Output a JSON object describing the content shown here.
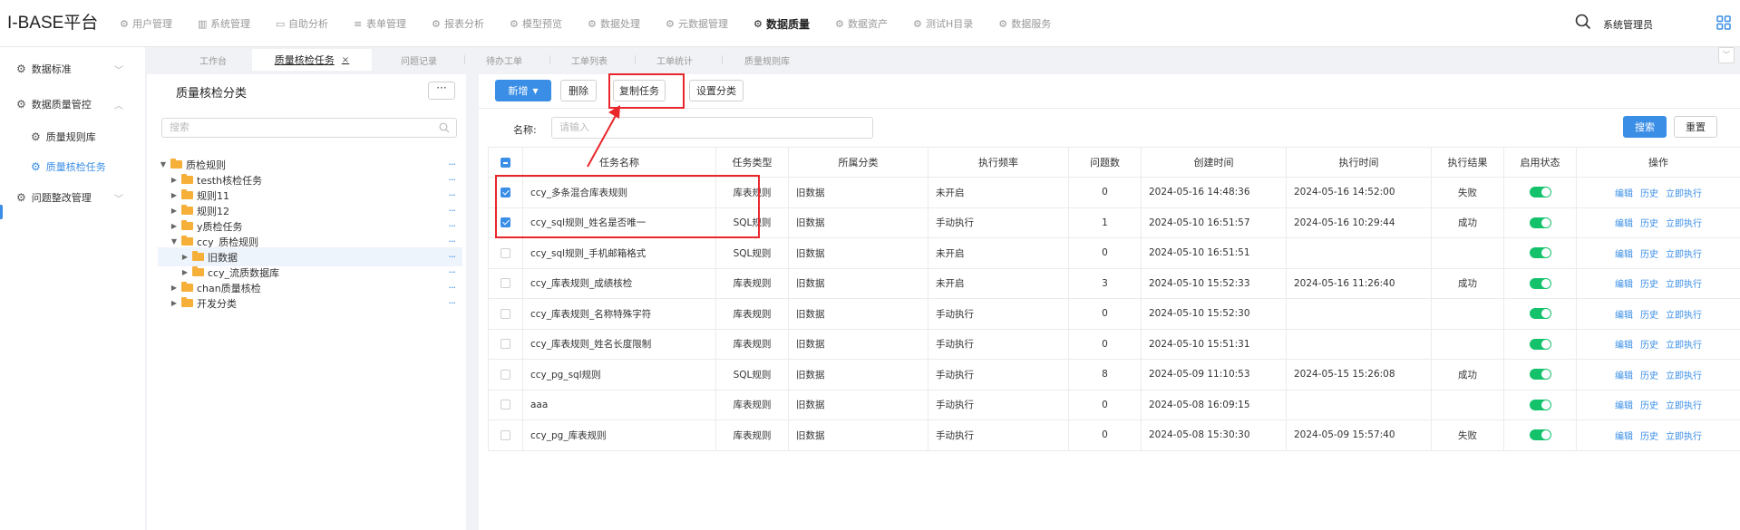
{
  "app": {
    "title": "I-BASE平台"
  },
  "topnav": [
    {
      "label": "用户管理",
      "icon": "gear-icon",
      "active": false
    },
    {
      "label": "系统管理",
      "icon": "chart-icon",
      "active": false
    },
    {
      "label": "自助分析",
      "icon": "monitor-icon",
      "active": false
    },
    {
      "label": "表单管理",
      "icon": "form-icon",
      "active": false
    },
    {
      "label": "报表分析",
      "icon": "gear-icon",
      "active": false
    },
    {
      "label": "模型预览",
      "icon": "gear-icon",
      "active": false
    },
    {
      "label": "数据处理",
      "icon": "gear-icon",
      "active": false
    },
    {
      "label": "元数据管理",
      "icon": "gear-icon",
      "active": false
    },
    {
      "label": "数据质量",
      "icon": "gear-icon",
      "active": true
    },
    {
      "label": "数据资产",
      "icon": "gear-icon",
      "active": false
    },
    {
      "label": "测试H目录",
      "icon": "gear-icon",
      "active": false
    },
    {
      "label": "数据服务",
      "icon": "gear-icon",
      "active": false
    }
  ],
  "user": {
    "name": "系统管理员"
  },
  "sidebar": {
    "items": [
      {
        "label": "数据标准"
      },
      {
        "label": "数据质量管控"
      },
      {
        "label": "质量规则库"
      },
      {
        "label": "质量核检任务"
      },
      {
        "label": "问题整改管理"
      }
    ]
  },
  "tabs": [
    {
      "label": "工作台"
    },
    {
      "label": "质量核检任务",
      "close": "×"
    },
    {
      "label": "问题记录"
    },
    {
      "label": "待办工单"
    },
    {
      "label": "工单列表"
    },
    {
      "label": "工单统计"
    },
    {
      "label": "质量规则库"
    }
  ],
  "tree": {
    "title": "质量核检分类",
    "more": "···",
    "search_placeholder": "搜索",
    "row_action": "···",
    "nodes": [
      {
        "label": "质检规则",
        "expanded": true
      },
      {
        "label": "testh核检任务"
      },
      {
        "label": "规则11"
      },
      {
        "label": "规则12"
      },
      {
        "label": "y质检任务"
      },
      {
        "label": "ccy_质检规则",
        "expanded": true
      },
      {
        "label": "旧数据",
        "selected": true
      },
      {
        "label": "ccy_流质数据库"
      },
      {
        "label": "chan质量核检"
      },
      {
        "label": "开发分类"
      }
    ]
  },
  "toolbar": {
    "add": "新增",
    "delete": "删除",
    "copy": "复制任务",
    "set_category": "设置分类",
    "search": "搜索",
    "reset": "重置"
  },
  "filter": {
    "name_label": "名称:",
    "name_placeholder": "请输入"
  },
  "table": {
    "headers": [
      "任务名称",
      "任务类型",
      "所属分类",
      "执行频率",
      "问题数",
      "创建时间",
      "执行时间",
      "执行结果",
      "启用状态",
      "操作"
    ],
    "actions": [
      "编辑",
      "历史",
      "立即执行"
    ],
    "rows": [
      {
        "checked": true,
        "name": "ccy_多条混合库表规则",
        "type": "库表规则",
        "category": "旧数据",
        "freq": "未开启",
        "issues": "0",
        "created": "2024-05-16 14:48:36",
        "executed": "2024-05-16 14:52:00",
        "result": "失败",
        "enabled": true
      },
      {
        "checked": true,
        "name": "ccy_sql规则_姓名是否唯一",
        "type": "SQL规则",
        "category": "旧数据",
        "freq": "手动执行",
        "issues": "1",
        "created": "2024-05-10 16:51:57",
        "executed": "2024-05-16 10:29:44",
        "result": "成功",
        "enabled": true
      },
      {
        "checked": false,
        "name": "ccy_sql规则_手机邮箱格式",
        "type": "SQL规则",
        "category": "旧数据",
        "freq": "未开启",
        "issues": "0",
        "created": "2024-05-10 16:51:51",
        "executed": "",
        "result": "",
        "enabled": true
      },
      {
        "checked": false,
        "name": "ccy_库表规则_成绩核检",
        "type": "库表规则",
        "category": "旧数据",
        "freq": "未开启",
        "issues": "3",
        "created": "2024-05-10 15:52:33",
        "executed": "2024-05-16 11:26:40",
        "result": "成功",
        "enabled": true
      },
      {
        "checked": false,
        "name": "ccy_库表规则_名称特殊字符",
        "type": "库表规则",
        "category": "旧数据",
        "freq": "手动执行",
        "issues": "0",
        "created": "2024-05-10 15:52:30",
        "executed": "",
        "result": "",
        "enabled": true
      },
      {
        "checked": false,
        "name": "ccy_库表规则_姓名长度限制",
        "type": "库表规则",
        "category": "旧数据",
        "freq": "手动执行",
        "issues": "0",
        "created": "2024-05-10 15:51:31",
        "executed": "",
        "result": "",
        "enabled": true
      },
      {
        "checked": false,
        "name": "ccy_pg_sql规则",
        "type": "SQL规则",
        "category": "旧数据",
        "freq": "手动执行",
        "issues": "8",
        "created": "2024-05-09 11:10:53",
        "executed": "2024-05-15 15:26:08",
        "result": "成功",
        "enabled": true
      },
      {
        "checked": false,
        "name": "aaa",
        "type": "库表规则",
        "category": "旧数据",
        "freq": "手动执行",
        "issues": "0",
        "created": "2024-05-08 16:09:15",
        "executed": "",
        "result": "",
        "enabled": true
      },
      {
        "checked": false,
        "name": "ccy_pg_库表规则",
        "type": "库表规则",
        "category": "旧数据",
        "freq": "手动执行",
        "issues": "0",
        "created": "2024-05-08 15:30:30",
        "executed": "2024-05-09 15:57:40",
        "result": "失败",
        "enabled": true
      }
    ]
  },
  "colors": {
    "accent": "#3a8ee6",
    "toggle_on": "#13c26b",
    "highlight": "#e8262b",
    "folder": "#f6b03a"
  }
}
